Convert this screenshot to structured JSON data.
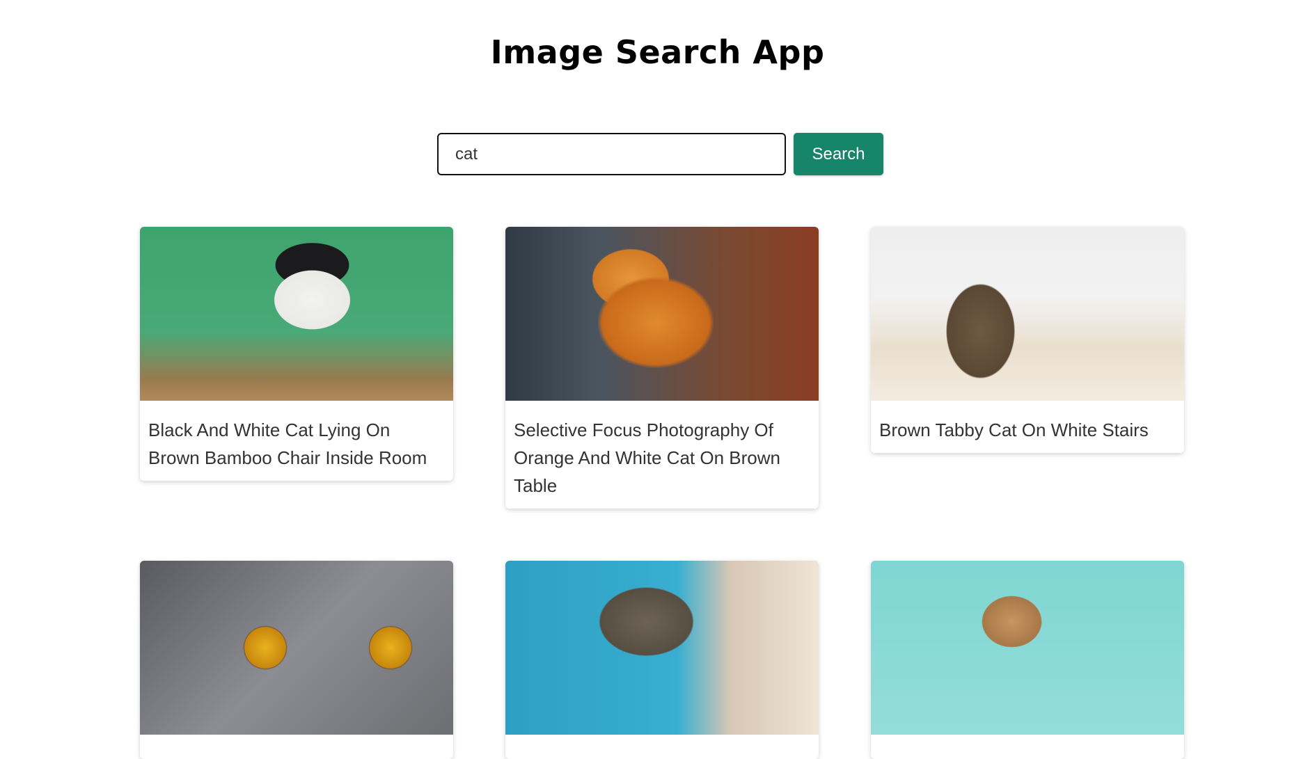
{
  "app": {
    "title": "Image Search App"
  },
  "search": {
    "value": "cat",
    "button_label": "Search"
  },
  "colors": {
    "accent": "#17856a",
    "background": "#ffffff",
    "text": "#333333"
  },
  "results": [
    {
      "title": "Black And White Cat Lying On Brown Bamboo Chair Inside Room"
    },
    {
      "title": "Selective Focus Photography Of Orange And White Cat On Brown Table"
    },
    {
      "title": "Brown Tabby Cat On White Stairs"
    },
    {
      "title": ""
    },
    {
      "title": ""
    },
    {
      "title": ""
    }
  ]
}
